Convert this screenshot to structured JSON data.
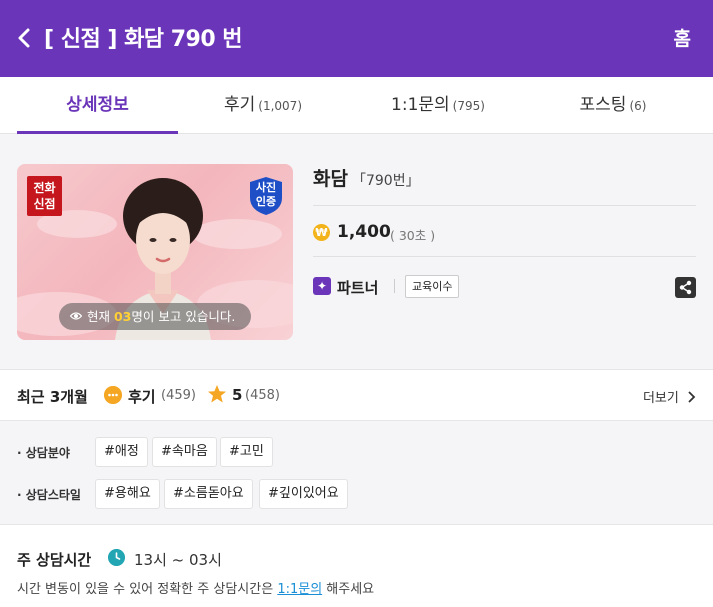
{
  "header": {
    "title": "[ 신점 ] 화담 790 번",
    "home_label": "홈"
  },
  "tabs": [
    {
      "label": "상세정보",
      "count": ""
    },
    {
      "label": "후기",
      "count": "(1,007)"
    },
    {
      "label": "1:1문의",
      "count": "(795)"
    },
    {
      "label": "포스팅",
      "count": "(6)"
    }
  ],
  "profile": {
    "badge_new_line1": "전화",
    "badge_new_line2": "신점",
    "badge_verified_line1": "사진",
    "badge_verified_line2": "인증",
    "viewing_prefix": "현재 ",
    "viewing_count": "03",
    "viewing_suffix": "명이 보고 있습니다.",
    "name": "화담",
    "code": "「790번」",
    "coin_icon": "₩",
    "price": "1,400",
    "price_unit": "( 30초 )",
    "partner_icon": "✦",
    "partner_label": "파트너",
    "edu_label": "교육이수"
  },
  "reviews": {
    "label": "최근 3개월",
    "review_label": "후기",
    "review_count": "(459)",
    "rating": "5",
    "rating_count": "(458)",
    "more_label": "더보기"
  },
  "tags": {
    "field_label": "· 상담분야",
    "field_tags": [
      "#애정",
      "#속마음",
      "#고민"
    ],
    "style_label": "· 상담스타일",
    "style_tags": [
      "#용해요",
      "#소름돋아요",
      "#깊이있어요"
    ]
  },
  "hours": {
    "label": "주 상담시간",
    "time": "13시 ~ 03시",
    "note_prefix": "시간 변동이 있을 수 있어 정확한 주 상담시간은 ",
    "note_link": "1:1문의",
    "note_suffix": " 해주세요"
  },
  "colors": {
    "brand": "#6a35b8",
    "badge_red": "#c4161c",
    "badge_blue": "#1f4fc7",
    "coin": "#f3b31a",
    "review_bubble": "#f5a623",
    "clock": "#22a6b3",
    "link": "#1a8fd6"
  }
}
